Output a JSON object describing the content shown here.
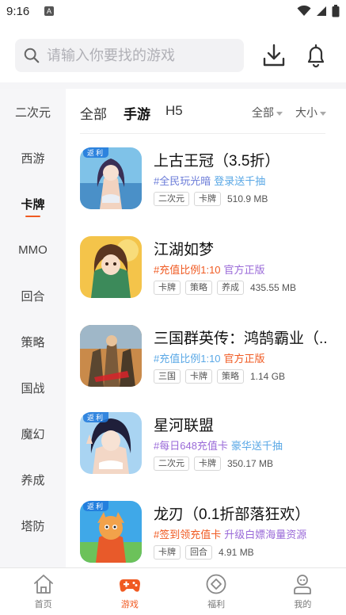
{
  "status": {
    "time": "9:16",
    "app_icon": "A"
  },
  "search": {
    "placeholder": "请输入你要找的游戏"
  },
  "sidebar": {
    "active_color": "#f05a22",
    "items": [
      {
        "label": "二次元"
      },
      {
        "label": "西游"
      },
      {
        "label": "卡牌"
      },
      {
        "label": "MMO"
      },
      {
        "label": "回合"
      },
      {
        "label": "策略"
      },
      {
        "label": "国战"
      },
      {
        "label": "魔幻"
      },
      {
        "label": "养成"
      },
      {
        "label": "塔防"
      }
    ],
    "selected_index": 2
  },
  "filters": {
    "tabs": [
      {
        "label": "全部"
      },
      {
        "label": "手游"
      },
      {
        "label": "H5"
      }
    ],
    "active_tab": 1,
    "dropdowns": [
      {
        "label": "全部"
      },
      {
        "label": "大小"
      }
    ]
  },
  "games": [
    {
      "title": "上古王冠（3.5折）",
      "badge": "返利",
      "promo1": "#全民玩光暗",
      "promo1_color": "#6a7bd8",
      "promo2": "登录送千抽",
      "promo2_color": "#5aa8e6",
      "tags": [
        "二次元",
        "卡牌"
      ],
      "size": "510.9 MB"
    },
    {
      "title": "江湖如梦",
      "badge": "",
      "promo1": "#充值比例1:10",
      "promo1_color": "#f05a22",
      "promo2": "官方正版",
      "promo2_color": "#9a6ad8",
      "tags": [
        "卡牌",
        "策略",
        "养成"
      ],
      "size": "435.55 MB"
    },
    {
      "title": "三国群英传：鸿鹄霸业（..",
      "badge": "",
      "promo1": "#充值比例1:10",
      "promo1_color": "#5aa8e6",
      "promo2": "官方正版",
      "promo2_color": "#f05a22",
      "tags": [
        "三国",
        "卡牌",
        "策略"
      ],
      "size": "1.14 GB"
    },
    {
      "title": "星河联盟",
      "badge": "返利",
      "promo1": "#每日648充值卡",
      "promo1_color": "#9a6ad8",
      "promo2": "豪华送千抽",
      "promo2_color": "#5aa8e6",
      "tags": [
        "二次元",
        "卡牌"
      ],
      "size": "350.17 MB"
    },
    {
      "title": "龙刃（0.1折部落狂欢）",
      "badge": "返利",
      "promo1": "#签到领充值卡",
      "promo1_color": "#f05a22",
      "promo2": "升级白嫖海量资源",
      "promo2_color": "#9a6ad8",
      "tags": [
        "卡牌",
        "回合"
      ],
      "size": "4.91 MB"
    }
  ],
  "bottom_nav": {
    "items": [
      {
        "label": "首页",
        "icon": "home-icon"
      },
      {
        "label": "游戏",
        "icon": "gamepad-icon"
      },
      {
        "label": "福利",
        "icon": "gift-diamond-icon"
      },
      {
        "label": "我的",
        "icon": "profile-icon"
      }
    ],
    "active_index": 1
  }
}
